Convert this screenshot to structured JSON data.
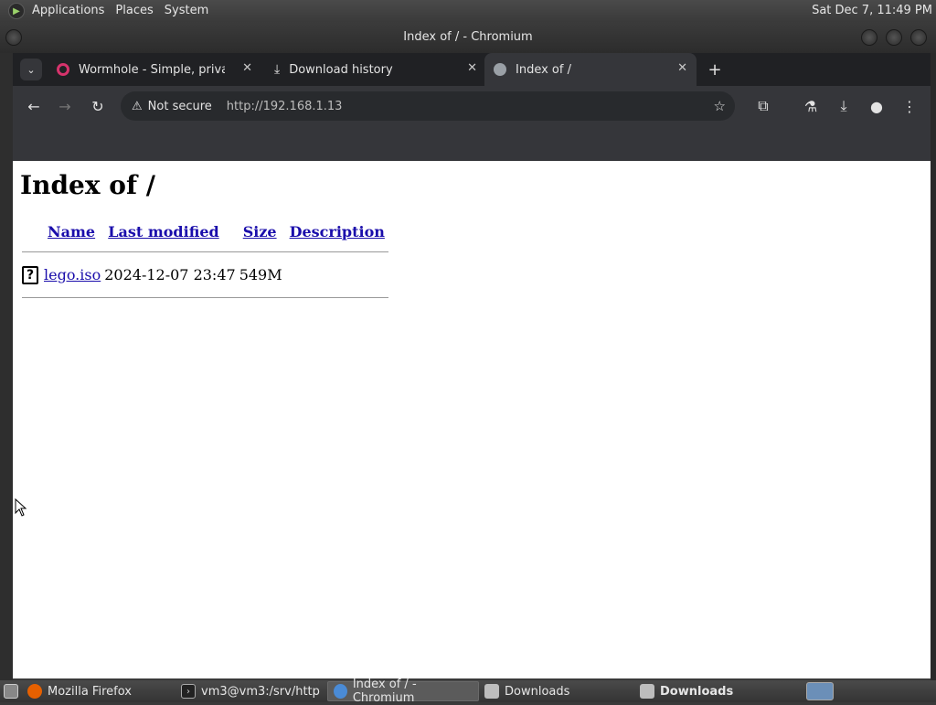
{
  "topbar": {
    "menus": [
      "Applications",
      "Places",
      "System"
    ],
    "clock": "Sat Dec 7, 11:49 PM"
  },
  "window": {
    "title": "Index of / - Chromium"
  },
  "browser": {
    "tabs": [
      {
        "title": "Wormhole - Simple, private fi",
        "icon": "wormhole-icon",
        "active": false
      },
      {
        "title": "Download history",
        "icon": "download-icon",
        "active": false
      },
      {
        "title": "Index of /",
        "icon": "globe-icon",
        "active": true
      }
    ],
    "omnibox": {
      "security": "Not secure",
      "url": "http://192.168.1.13"
    }
  },
  "page": {
    "heading": "Index of /",
    "columns": [
      "Name",
      "Last modified",
      "Size",
      "Description"
    ],
    "rows": [
      {
        "name": "lego.iso",
        "modified": "2024-12-07 23:47",
        "size": "549M",
        "description": ""
      }
    ]
  },
  "taskbar": {
    "items": [
      {
        "label": "Mozilla Firefox",
        "icon": "firefox-icon",
        "active": false
      },
      {
        "label": "vm3@vm3:/srv/http",
        "icon": "terminal-icon",
        "active": false
      },
      {
        "label": "Index of / - Chromium",
        "icon": "chromium-icon",
        "active": true
      },
      {
        "label": "Downloads",
        "icon": "folder-icon",
        "active": false
      },
      {
        "label": "Downloads",
        "icon": "folder-icon",
        "active": false
      }
    ]
  }
}
